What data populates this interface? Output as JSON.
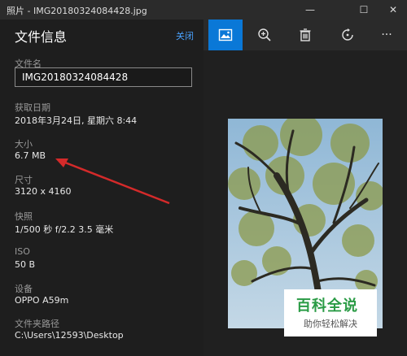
{
  "window": {
    "title": "照片 - IMG20180324084428.jpg",
    "minimize": "—",
    "maximize": "☐",
    "close": "✕"
  },
  "panel": {
    "title": "文件信息",
    "close_link": "关闭",
    "fields": {
      "filename_label": "文件名",
      "filename_value": "IMG20180324084428",
      "date_label": "获取日期",
      "date_value": "2018年3月24日, 星期六 8:44",
      "size_label": "大小",
      "size_value": "6.7 MB",
      "dims_label": "尺寸",
      "dims_value": "3120 x 4160",
      "shot_label": "快照",
      "shot_value": "1/500 秒 f/2.2 3.5 毫米",
      "iso_label": "ISO",
      "iso_value": "50 B",
      "device_label": "设备",
      "device_value": "OPPO A59m",
      "path_label": "文件夹路径",
      "path_value": "C:\\Users\\12593\\Desktop"
    }
  },
  "toolbar": {
    "icons": [
      "image-icon",
      "zoom-in-icon",
      "trash-icon",
      "rotate-icon",
      "more-icon"
    ],
    "more": "···"
  },
  "watermark": {
    "main": "百科全说",
    "sub": "助你轻松解决"
  },
  "colors": {
    "accent": "#0a78d7",
    "link": "#4aa3ff",
    "arrow": "#d42a2a",
    "watermark_green": "#2a9b45"
  }
}
